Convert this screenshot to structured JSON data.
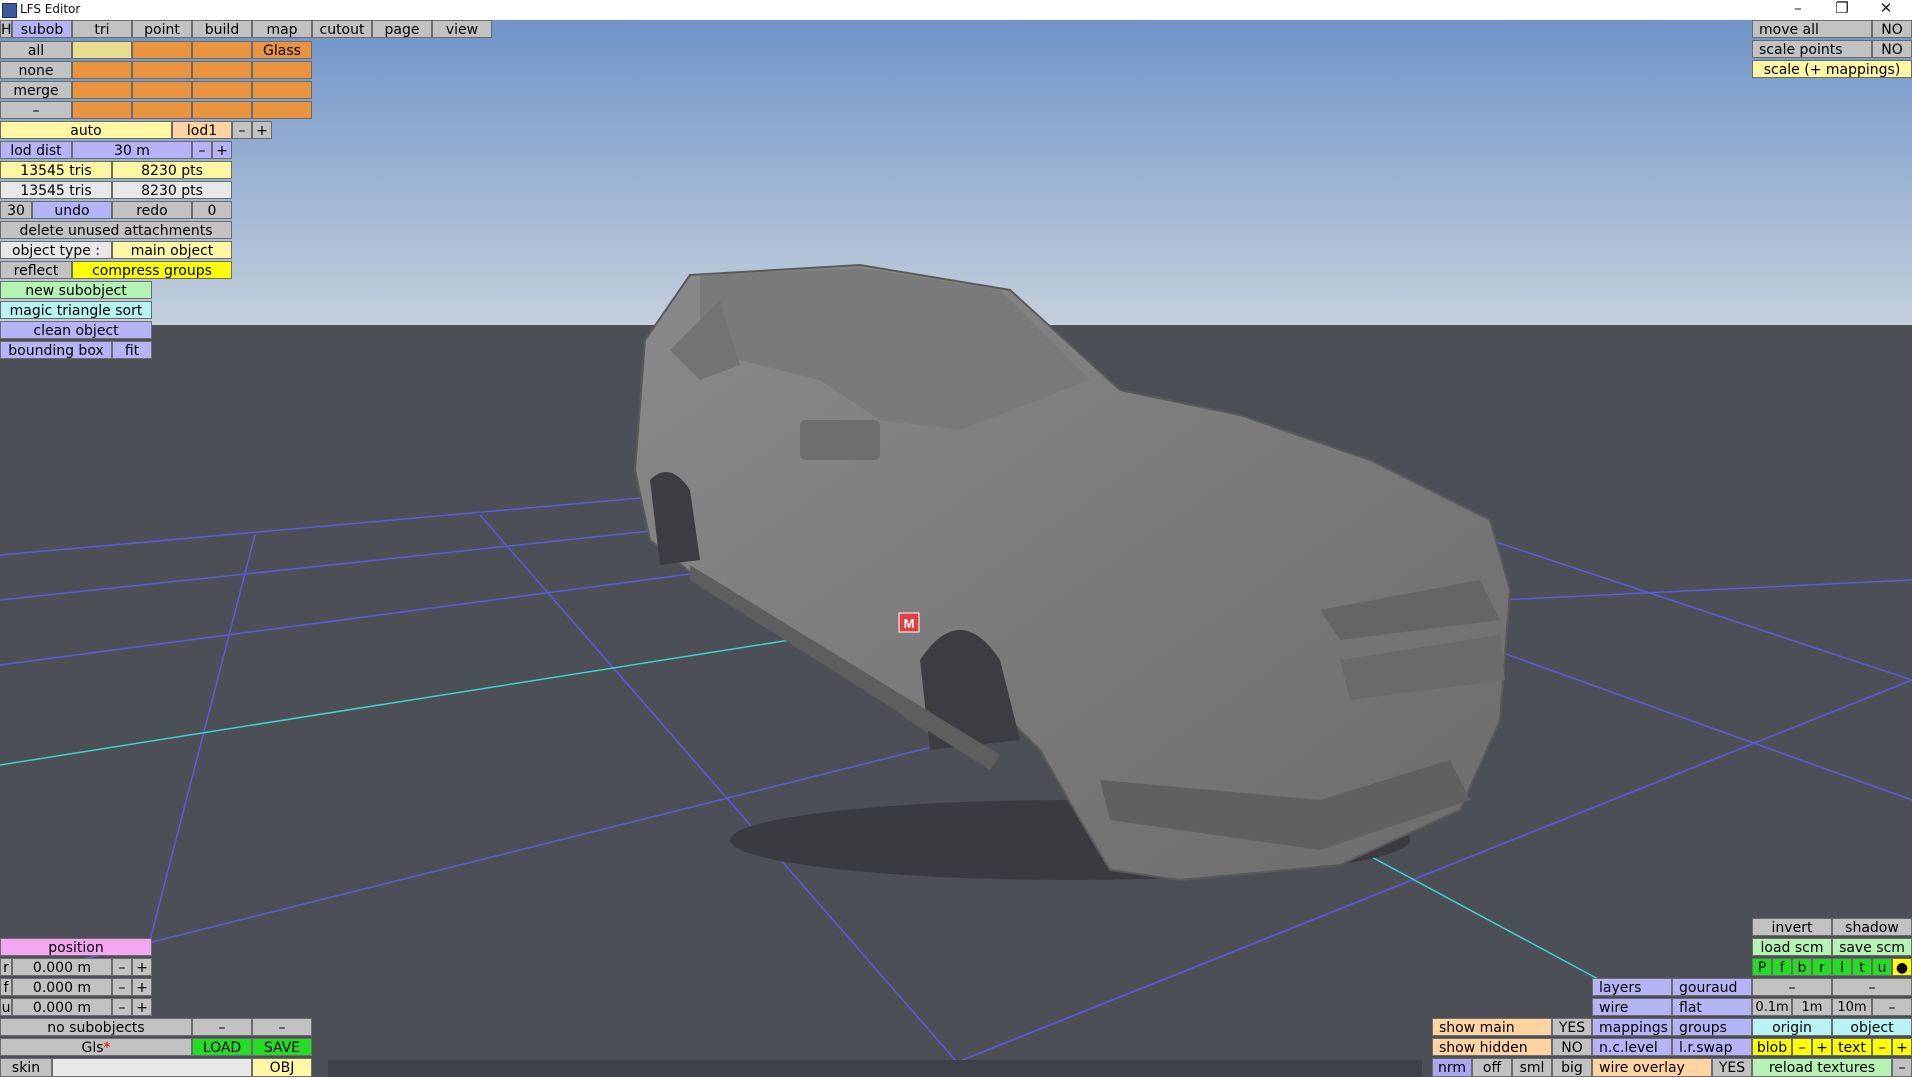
{
  "window": {
    "title": "LFS Editor",
    "minimize": "–",
    "restore": "❐",
    "close": "✕"
  },
  "menu": {
    "h": "H",
    "tabs": [
      "subob",
      "tri",
      "point",
      "build",
      "map",
      "cutout",
      "page",
      "view"
    ]
  },
  "select_rows": {
    "all": "all",
    "none": "none",
    "merge": "merge",
    "dash": "–",
    "glass": "Glass"
  },
  "lod": {
    "auto": "auto",
    "lod1": "lod1",
    "minus": "–",
    "plus": "+",
    "dist_label": "lod dist",
    "dist_value": "30 m"
  },
  "stats": {
    "tris1": "13545 tris",
    "pts1": "8230 pts",
    "tris2": "13545 tris",
    "pts2": "8230 pts"
  },
  "history": {
    "count": "30",
    "undo": "undo",
    "redo": "redo",
    "redo_count": "0"
  },
  "actions": {
    "delete_unused": "delete unused attachments",
    "object_type_label": "object type :",
    "object_type_value": "main object",
    "reflect": "reflect",
    "compress_groups": "compress groups",
    "new_subobject": "new subobject",
    "magic_sort": "magic triangle sort",
    "clean_object": "clean object",
    "bounding_box": "bounding box",
    "fit": "fit"
  },
  "position": {
    "title": "position",
    "rows": [
      {
        "axis": "r",
        "value": "0.000 m"
      },
      {
        "axis": "f",
        "value": "0.000 m"
      },
      {
        "axis": "u",
        "value": "0.000 m"
      }
    ],
    "minus": "–",
    "plus": "+"
  },
  "bottom_left": {
    "no_subobjects": "no subobjects",
    "dash": "–",
    "gls": "Gls",
    "star": "*",
    "load": "LOAD",
    "save": "SAVE",
    "skin": "skin",
    "obj": "OBJ"
  },
  "top_right": {
    "move_all": "move all",
    "move_all_val": "NO",
    "scale_points": "scale points",
    "scale_points_val": "NO",
    "scale_mappings": "scale (+ mappings)"
  },
  "bottom_right": {
    "invert": "invert",
    "shadow": "shadow",
    "load_scm": "load scm",
    "save_scm": "save scm",
    "letters": [
      "P",
      "f",
      "b",
      "r",
      "l",
      "t",
      "u",
      "●"
    ],
    "layers": "layers",
    "gouraud": "gouraud",
    "dash": "–",
    "wire": "wire",
    "flat": "flat",
    "g01": "0.1m",
    "g1": "1m",
    "g10": "10m",
    "show_main": "show main",
    "show_main_val": "YES",
    "mappings": "mappings",
    "groups": "groups",
    "origin": "origin",
    "object": "object",
    "show_hidden": "show hidden",
    "show_hidden_val": "NO",
    "nclevel": "n.c.level",
    "lrswap": "l.r.swap",
    "blob": "blob",
    "minus": "–",
    "plus": "+",
    "text": "text",
    "nrm": "nrm",
    "off": "off",
    "sml": "sml",
    "big": "big",
    "wire_overlay": "wire overlay",
    "wire_overlay_val": "YES",
    "reload_textures": "reload textures"
  },
  "scene": {
    "marker": "M"
  }
}
